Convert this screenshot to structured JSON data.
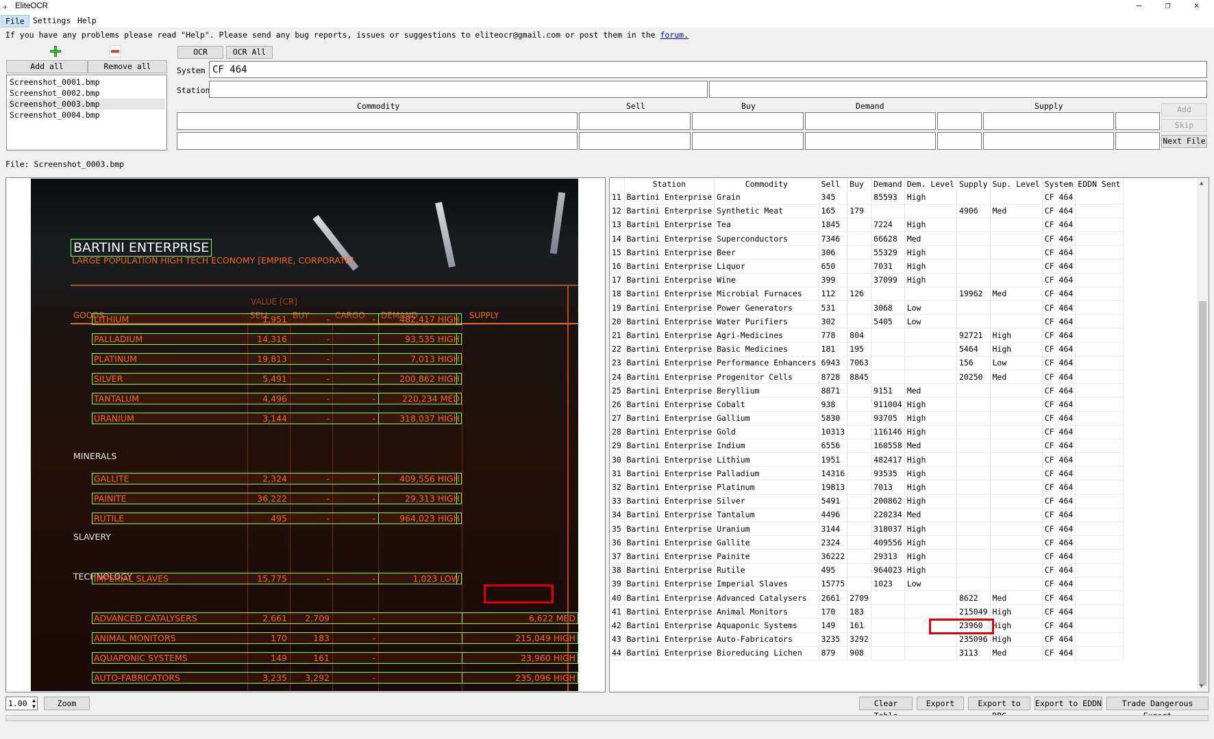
{
  "window": {
    "title": "EliteOCR",
    "min": "–",
    "max": "❐",
    "close": "✕"
  },
  "menu": [
    "File",
    "Settings",
    "Help"
  ],
  "info": {
    "text": "If you have any problems please read \"Help\". Please send any bug reports, issues or suggestions to eliteocr@gmail.com or post them in the ",
    "link": "forum."
  },
  "files": {
    "add_all": "Add all",
    "remove_all": "Remove all",
    "items": [
      "Screenshot_0001.bmp",
      "Screenshot_0002.bmp",
      "Screenshot_0003.bmp",
      "Screenshot_0004.bmp"
    ],
    "current": "File: Screenshot_0003.bmp"
  },
  "ocr": {
    "ocr": "OCR",
    "ocr_all": "OCR All",
    "system_label": "System",
    "system_value": "CF 464",
    "station_label": "Station",
    "station_value": ""
  },
  "form": {
    "headers": [
      "Commodity",
      "Sell",
      "Buy",
      "Demand",
      "Supply"
    ],
    "add": "Add",
    "skip": "Skip",
    "next": "Next File"
  },
  "bottom": {
    "zoom_value": "1.00",
    "zoom": "Zoom",
    "clear": "Clear Table",
    "export": "Export",
    "export_bpc": "Export to BPC",
    "export_eddn": "Export to EDDN",
    "tde": "Trade Dangerous Export"
  },
  "colors": {
    "accent": "#ee6a1c",
    "green_box": "#7fff3a",
    "red_box": "#e10000"
  },
  "game": {
    "station": "BARTINI ENTERPRISE",
    "subtitle": "LARGE POPULATION HIGH TECH ECONOMY [EMPIRE, CORPORATE]",
    "value_cr": "VALUE [CR]",
    "cols": [
      "GOODS",
      "SELL",
      "BUY",
      "CARGO",
      "DEMAND",
      "SUPPLY"
    ],
    "sections": [
      "MINERALS",
      "SLAVERY",
      "TECHNOLOGY"
    ],
    "rows": [
      {
        "name": "LITHIUM",
        "sell": "1,951",
        "buy": "-",
        "cargo": "-",
        "demand": "482,417 HIGH",
        "supply": ""
      },
      {
        "name": "PALLADIUM",
        "sell": "14,316",
        "buy": "-",
        "cargo": "-",
        "demand": "93,535 HIGH",
        "supply": ""
      },
      {
        "name": "PLATINUM",
        "sell": "19,813",
        "buy": "-",
        "cargo": "-",
        "demand": "7,013 HIGH",
        "supply": ""
      },
      {
        "name": "SILVER",
        "sell": "5,491",
        "buy": "-",
        "cargo": "-",
        "demand": "200,862 HIGH",
        "supply": ""
      },
      {
        "name": "TANTALUM",
        "sell": "4,496",
        "buy": "-",
        "cargo": "-",
        "demand": "220,234 MED",
        "supply": ""
      },
      {
        "name": "URANIUM",
        "sell": "3,144",
        "buy": "-",
        "cargo": "-",
        "demand": "318,037 HIGH",
        "supply": ""
      },
      {
        "name": "GALLITE",
        "sell": "2,324",
        "buy": "-",
        "cargo": "-",
        "demand": "409,556 HIGH",
        "supply": ""
      },
      {
        "name": "PAINITE",
        "sell": "36,222",
        "buy": "-",
        "cargo": "-",
        "demand": "29,313 HIGH",
        "supply": ""
      },
      {
        "name": "RUTILE",
        "sell": "495",
        "buy": "-",
        "cargo": "-",
        "demand": "964,023 HIGH",
        "supply": ""
      },
      {
        "name": "IMPERIAL SLAVES",
        "sell": "15,775",
        "buy": "-",
        "cargo": "-",
        "demand": "1,023 LOW",
        "supply": ""
      },
      {
        "name": "ADVANCED CATALYSERS",
        "sell": "2,661",
        "buy": "2,709",
        "cargo": "-",
        "demand": "",
        "supply": "6,622 MED"
      },
      {
        "name": "ANIMAL MONITORS",
        "sell": "170",
        "buy": "183",
        "cargo": "-",
        "demand": "",
        "supply": "215,049 HIGH"
      },
      {
        "name": "AQUAPONIC SYSTEMS",
        "sell": "149",
        "buy": "161",
        "cargo": "-",
        "demand": "",
        "supply": "23,960 HIGH"
      },
      {
        "name": "AUTO-FABRICATORS",
        "sell": "3,235",
        "buy": "3,292",
        "cargo": "-",
        "demand": "",
        "supply": "235,096 HIGH"
      },
      {
        "name": "BIOREDUCING LICHEN",
        "sell": "879",
        "buy": "908",
        "cargo": "-",
        "demand": "",
        "supply": "3,113 MED"
      }
    ]
  },
  "table": {
    "headers": [
      "",
      "Station",
      "Commodity",
      "Sell",
      "Buy",
      "Demand",
      "Dem. Level",
      "Supply",
      "Sup. Level",
      "System",
      "EDDN Sent"
    ],
    "rows": [
      [
        "11",
        "Bartini Enterprise",
        "Grain",
        "345",
        "",
        "85593",
        "High",
        "",
        "",
        "CF 464",
        ""
      ],
      [
        "12",
        "Bartini Enterprise",
        "Synthetic Meat",
        "165",
        "179",
        "",
        "",
        "4906",
        "Med",
        "CF 464",
        ""
      ],
      [
        "13",
        "Bartini Enterprise",
        "Tea",
        "1845",
        "",
        "7224",
        "High",
        "",
        "",
        "CF 464",
        ""
      ],
      [
        "14",
        "Bartini Enterprise",
        "Superconductors",
        "7346",
        "",
        "66628",
        "Med",
        "",
        "",
        "CF 464",
        ""
      ],
      [
        "15",
        "Bartini Enterprise",
        "Beer",
        "306",
        "",
        "55329",
        "High",
        "",
        "",
        "CF 464",
        ""
      ],
      [
        "16",
        "Bartini Enterprise",
        "Liquor",
        "650",
        "",
        "7031",
        "High",
        "",
        "",
        "CF 464",
        ""
      ],
      [
        "17",
        "Bartini Enterprise",
        "Wine",
        "399",
        "",
        "37099",
        "High",
        "",
        "",
        "CF 464",
        ""
      ],
      [
        "18",
        "Bartini Enterprise",
        "Microbial Furnaces",
        "112",
        "126",
        "",
        "",
        "19962",
        "Med",
        "CF 464",
        ""
      ],
      [
        "19",
        "Bartini Enterprise",
        "Power Generators",
        "531",
        "",
        "3068",
        "Low",
        "",
        "",
        "CF 464",
        ""
      ],
      [
        "20",
        "Bartini Enterprise",
        "Water Purifiers",
        "302",
        "",
        "5405",
        "Low",
        "",
        "",
        "CF 464",
        ""
      ],
      [
        "21",
        "Bartini Enterprise",
        "Agri-Medicines",
        "778",
        "804",
        "",
        "",
        "92721",
        "High",
        "CF 464",
        ""
      ],
      [
        "22",
        "Bartini Enterprise",
        "Basic Medicines",
        "181",
        "195",
        "",
        "",
        "5464",
        "High",
        "CF 464",
        ""
      ],
      [
        "23",
        "Bartini Enterprise",
        "Performance Enhancers",
        "6943",
        "7063",
        "",
        "",
        "156",
        "Low",
        "CF 464",
        ""
      ],
      [
        "24",
        "Bartini Enterprise",
        "Progenitor Cells",
        "8728",
        "8845",
        "",
        "",
        "20250",
        "Med",
        "CF 464",
        ""
      ],
      [
        "25",
        "Bartini Enterprise",
        "Beryllium",
        "8871",
        "",
        "9151",
        "Med",
        "",
        "",
        "CF 464",
        ""
      ],
      [
        "26",
        "Bartini Enterprise",
        "Cobalt",
        "938",
        "",
        "911004",
        "High",
        "",
        "",
        "CF 464",
        ""
      ],
      [
        "27",
        "Bartini Enterprise",
        "Gallium",
        "5830",
        "",
        "93705",
        "High",
        "",
        "",
        "CF 464",
        ""
      ],
      [
        "28",
        "Bartini Enterprise",
        "Gold",
        "10313",
        "",
        "116146",
        "High",
        "",
        "",
        "CF 464",
        ""
      ],
      [
        "29",
        "Bartini Enterprise",
        "Indium",
        "6556",
        "",
        "160558",
        "Med",
        "",
        "",
        "CF 464",
        ""
      ],
      [
        "30",
        "Bartini Enterprise",
        "Lithium",
        "1951",
        "",
        "482417",
        "High",
        "",
        "",
        "CF 464",
        ""
      ],
      [
        "31",
        "Bartini Enterprise",
        "Palladium",
        "14316",
        "",
        "93535",
        "High",
        "",
        "",
        "CF 464",
        ""
      ],
      [
        "32",
        "Bartini Enterprise",
        "Platinum",
        "19813",
        "",
        "7013",
        "High",
        "",
        "",
        "CF 464",
        ""
      ],
      [
        "33",
        "Bartini Enterprise",
        "Silver",
        "5491",
        "",
        "200862",
        "High",
        "",
        "",
        "CF 464",
        ""
      ],
      [
        "34",
        "Bartini Enterprise",
        "Tantalum",
        "4496",
        "",
        "220234",
        "Med",
        "",
        "",
        "CF 464",
        ""
      ],
      [
        "35",
        "Bartini Enterprise",
        "Uranium",
        "3144",
        "",
        "318037",
        "High",
        "",
        "",
        "CF 464",
        ""
      ],
      [
        "36",
        "Bartini Enterprise",
        "Gallite",
        "2324",
        "",
        "409556",
        "High",
        "",
        "",
        "CF 464",
        ""
      ],
      [
        "37",
        "Bartini Enterprise",
        "Painite",
        "36222",
        "",
        "29313",
        "High",
        "",
        "",
        "CF 464",
        ""
      ],
      [
        "38",
        "Bartini Enterprise",
        "Rutile",
        "495",
        "",
        "964023",
        "High",
        "",
        "",
        "CF 464",
        ""
      ],
      [
        "39",
        "Bartini Enterprise",
        "Imperial Slaves",
        "15775",
        "",
        "1023",
        "Low",
        "",
        "",
        "CF 464",
        ""
      ],
      [
        "40",
        "Bartini Enterprise",
        "Advanced Catalysers",
        "2661",
        "2709",
        "",
        "",
        "8622",
        "Med",
        "CF 464",
        ""
      ],
      [
        "41",
        "Bartini Enterprise",
        "Animal Monitors",
        "170",
        "183",
        "",
        "",
        "215049",
        "High",
        "CF 464",
        ""
      ],
      [
        "42",
        "Bartini Enterprise",
        "Aquaponic Systems",
        "149",
        "161",
        "",
        "",
        "23960",
        "High",
        "CF 464",
        ""
      ],
      [
        "43",
        "Bartini Enterprise",
        "Auto-Fabricators",
        "3235",
        "3292",
        "",
        "",
        "235096",
        "High",
        "CF 464",
        ""
      ],
      [
        "44",
        "Bartini Enterprise",
        "Bioreducing Lichen",
        "879",
        "908",
        "",
        "",
        "3113",
        "Med",
        "CF 464",
        ""
      ]
    ]
  }
}
